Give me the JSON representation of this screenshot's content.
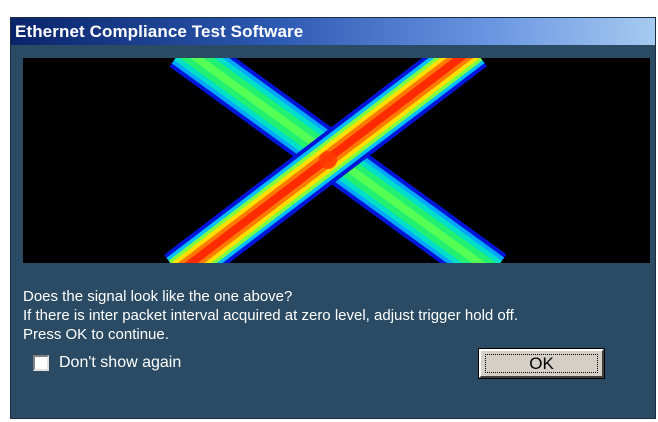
{
  "window": {
    "title": "Ethernet Compliance Test Software"
  },
  "preview": {
    "description_icon": "eye-diagram-image"
  },
  "message": {
    "line1": "Does the signal look like the one above?",
    "line2": "If there is inter packet interval acquired at zero level, adjust trigger hold off.",
    "line3": "Press OK to continue."
  },
  "checkbox": {
    "label": "Don't show again",
    "checked": false
  },
  "buttons": {
    "ok_label": "OK"
  },
  "colors": {
    "window_bg": "#2a4b63",
    "title_start": "#0a246a",
    "title_end": "#a6caf0"
  }
}
